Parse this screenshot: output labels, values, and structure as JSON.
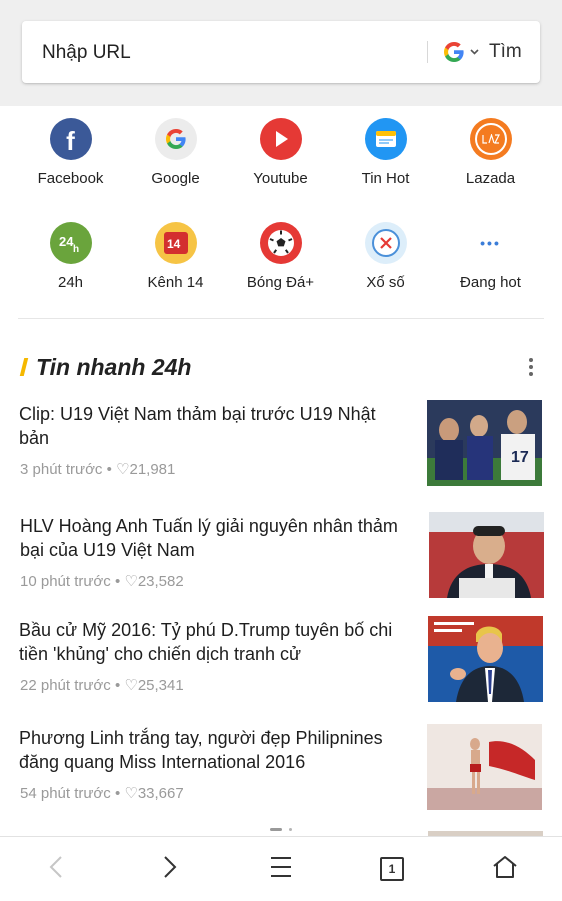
{
  "search": {
    "placeholder": "Nhập URL",
    "button_label": "Tìm",
    "engine_icon": "google-g-icon"
  },
  "quick_links": [
    {
      "label": "Facebook",
      "icon": "facebook-icon",
      "color": "#3b5998"
    },
    {
      "label": "Google",
      "icon": "google-icon",
      "color": "#ececec"
    },
    {
      "label": "Youtube",
      "icon": "youtube-icon",
      "color": "#e53935"
    },
    {
      "label": "Tin Hot",
      "icon": "tin-hot-icon",
      "color": "#2196f3"
    },
    {
      "label": "Lazada",
      "icon": "lazada-icon",
      "color": "#f47b20"
    },
    {
      "label": "24h",
      "icon": "24h-icon",
      "color": "#6aa43c"
    },
    {
      "label": "Kênh 14",
      "icon": "kenh14-icon",
      "color": "#d32f2f"
    },
    {
      "label": "Bóng Đá+",
      "icon": "soccer-ball-icon",
      "color": "#e53935"
    },
    {
      "label": "Xổ số",
      "icon": "lottery-icon",
      "color": "#4a90d9"
    },
    {
      "label": "Đang hot",
      "icon": "more-dots-icon",
      "color": "#3b7dd8",
      "dots": "•••"
    }
  ],
  "section": {
    "title": "Tin nhanh 24h",
    "accent": "#f5b800"
  },
  "news": [
    {
      "title": "Clip: U19 Việt Nam thảm bại trước U19 Nhật bản",
      "time": "3 phút trước",
      "likes": "21,981"
    },
    {
      "title": "HLV Hoàng Anh Tuấn lý giải nguyên nhân thảm  bại của U19 Việt Nam",
      "time": "10 phút trước",
      "likes": "23,582"
    },
    {
      "title": "Bầu cử Mỹ 2016: Tỷ phú D.Trump tuyên bố chi tiền 'khủng' cho chiến dịch tranh cử",
      "time": "22 phút trước",
      "likes": "25,341"
    },
    {
      "title": "Phương Linh trắng tay, người đẹp Philipnines đăng quang Miss International 2016",
      "time": "54 phút trước",
      "likes": "33,667"
    }
  ],
  "news_meta_sep": "•",
  "like_icon": "♡",
  "bottom_nav": {
    "tab_count": "1"
  }
}
